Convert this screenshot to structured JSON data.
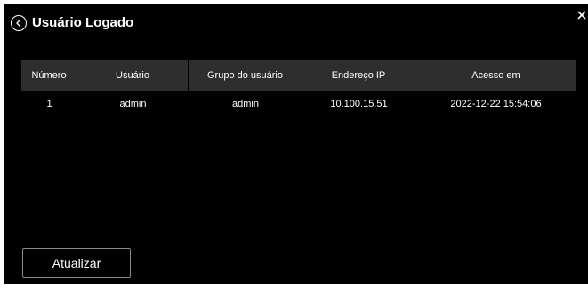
{
  "dialog": {
    "title": "Usuário Logado",
    "back_icon": "circle-chevron-left-icon",
    "close_icon": "close-icon"
  },
  "table": {
    "columns": [
      "Número",
      "Usuário",
      "Grupo do usuário",
      "Endereço IP",
      "Acesso em"
    ],
    "rows": [
      [
        "1",
        "admin",
        "admin",
        "10.100.15.51",
        "2022-12-22 15:54:06"
      ]
    ]
  },
  "buttons": {
    "refresh_label": "Atualizar"
  },
  "colors": {
    "background": "#000000",
    "header": "#2e2e2e",
    "text": "#ffffff",
    "button_border": "#8a8a8a"
  }
}
